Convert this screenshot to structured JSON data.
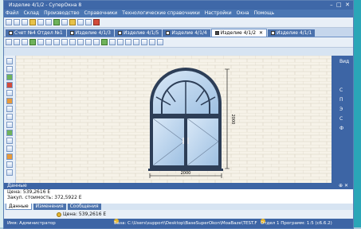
{
  "title": "Изделие 4/1/2 - СуперОкна 8",
  "menu": [
    "Файл",
    "Склад",
    "Производство",
    "Справочники",
    "Технологические справочники",
    "Настройки",
    "Окна",
    "Помощь"
  ],
  "tabs": [
    {
      "label": "Счет №4 Отдел №1",
      "active": false
    },
    {
      "label": "Изделие 4/1/3",
      "active": false
    },
    {
      "label": "Изделие 4/1/5",
      "active": false
    },
    {
      "label": "Изделие 4/1/4",
      "active": false
    },
    {
      "label": "Изделие 4/1/2",
      "active": true
    },
    {
      "label": "Изделие 4/1/1",
      "active": false
    }
  ],
  "drawing": {
    "width_dim": "2000",
    "height_dim": "2000"
  },
  "right_panel": {
    "top": "Вид",
    "labels": [
      "С",
      "П",
      "Э",
      "С",
      "Ф"
    ]
  },
  "data_panel": {
    "title": "Данные",
    "line1": "Цена: 539,2616 Е",
    "line2": "Закуп. стоимость: 372,5922 Е"
  },
  "panel_tabs": [
    {
      "label": "Данные",
      "active": true
    },
    {
      "label": "Изменения",
      "active": false
    },
    {
      "label": "Сообщения",
      "active": false
    }
  ],
  "price_label": "Цена: 539,2616 Е",
  "status": {
    "user": "Имя: Администратор",
    "base": "База: C:\\Users\\support\\Desktop\\BaseSuperOkon\\MoaBaze\\TEST.F",
    "dept": "Отдел 1 Программ: 1:5 (c6.6.2)"
  },
  "colors": {
    "titlebar": "#3f68a8",
    "menubar": "#4a76b3",
    "frame": "#5b7fb4"
  }
}
